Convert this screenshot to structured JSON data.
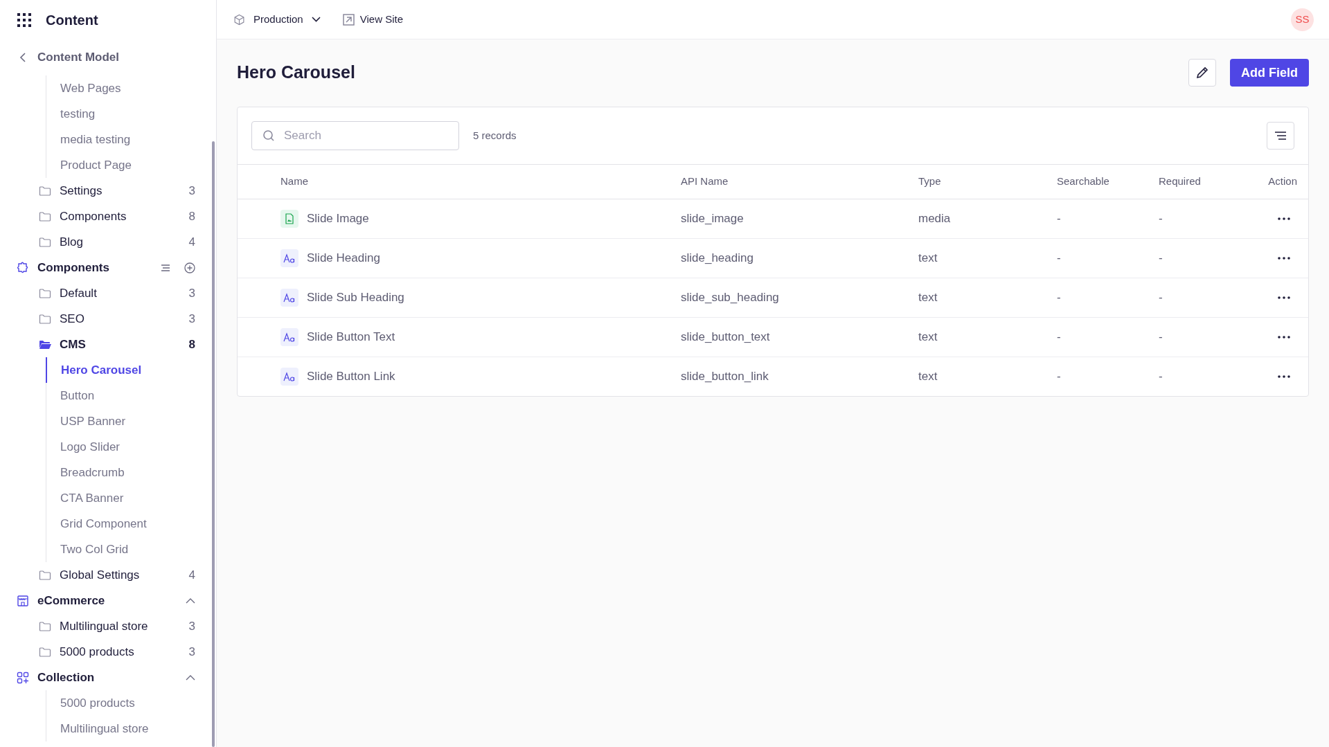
{
  "app": {
    "title": "Content"
  },
  "topbar": {
    "environment": "Production",
    "view_site": "View Site",
    "avatar": "SS"
  },
  "sidebar": {
    "back_label": "Content Model",
    "items": [
      {
        "kind": "page",
        "label": "Web Pages",
        "selected": false
      },
      {
        "kind": "page",
        "label": "testing",
        "selected": false
      },
      {
        "kind": "page",
        "label": "media testing",
        "selected": false
      },
      {
        "kind": "page",
        "label": "Product Page",
        "selected": false
      },
      {
        "kind": "folder",
        "label": "Settings",
        "count": "3",
        "selected": false
      },
      {
        "kind": "folder",
        "label": "Components",
        "count": "8",
        "selected": false
      },
      {
        "kind": "folder",
        "label": "Blog",
        "count": "4",
        "selected": false
      },
      {
        "kind": "group",
        "label": "Components",
        "actions": true,
        "expanded": true,
        "children": [
          {
            "kind": "folder",
            "label": "Default",
            "count": "3",
            "selected": false
          },
          {
            "kind": "folder",
            "label": "SEO",
            "count": "3",
            "selected": false
          },
          {
            "kind": "folder",
            "label": "CMS",
            "count": "8",
            "selected": true,
            "children": [
              {
                "kind": "page",
                "label": "Hero Carousel",
                "selected": true
              },
              {
                "kind": "page",
                "label": "Button",
                "selected": false
              },
              {
                "kind": "page",
                "label": "USP Banner",
                "selected": false
              },
              {
                "kind": "page",
                "label": "Logo Slider",
                "selected": false
              },
              {
                "kind": "page",
                "label": "Breadcrumb",
                "selected": false
              },
              {
                "kind": "page",
                "label": "CTA Banner",
                "selected": false
              },
              {
                "kind": "page",
                "label": "Grid Component",
                "selected": false
              },
              {
                "kind": "page",
                "label": "Two Col Grid",
                "selected": false
              }
            ]
          },
          {
            "kind": "folder",
            "label": "Global Settings",
            "count": "4",
            "selected": false
          }
        ]
      },
      {
        "kind": "group",
        "label": "eCommerce",
        "actions": false,
        "expanded": true,
        "children": [
          {
            "kind": "folder",
            "label": "Multilingual store",
            "count": "3",
            "selected": false
          },
          {
            "kind": "folder",
            "label": "5000 products",
            "count": "3",
            "selected": false
          }
        ]
      },
      {
        "kind": "group",
        "label": "Collection",
        "actions": false,
        "expanded": true,
        "children": [
          {
            "kind": "page",
            "label": "5000 products",
            "selected": false
          },
          {
            "kind": "page",
            "label": "Multilingual store",
            "selected": false
          }
        ]
      }
    ]
  },
  "page": {
    "title": "Hero Carousel",
    "primary_button": "Add Field"
  },
  "table": {
    "search_placeholder": "Search",
    "record_count": "5 records",
    "columns": [
      "Name",
      "API Name",
      "Type",
      "Searchable",
      "Required",
      "Action"
    ],
    "rows": [
      {
        "kind": "media",
        "name": "Slide Image",
        "api_name": "slide_image",
        "type": "media",
        "searchable": "-",
        "required": "-"
      },
      {
        "kind": "text",
        "name": "Slide Heading",
        "api_name": "slide_heading",
        "type": "text",
        "searchable": "-",
        "required": "-"
      },
      {
        "kind": "text",
        "name": "Slide Sub Heading",
        "api_name": "slide_sub_heading",
        "type": "text",
        "searchable": "-",
        "required": "-"
      },
      {
        "kind": "text",
        "name": "Slide Button Text",
        "api_name": "slide_button_text",
        "type": "text",
        "searchable": "-",
        "required": "-"
      },
      {
        "kind": "text",
        "name": "Slide Button Link",
        "api_name": "slide_button_link",
        "type": "text",
        "searchable": "-",
        "required": "-"
      }
    ]
  }
}
